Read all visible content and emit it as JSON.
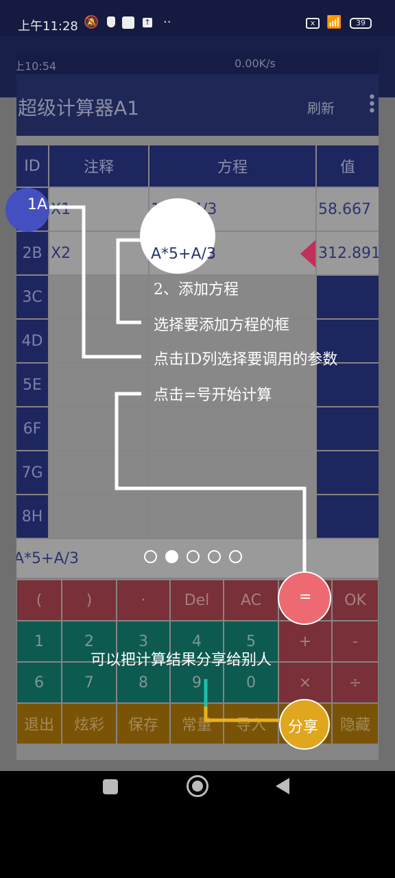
{
  "status_bar": {
    "time": "上午11:28",
    "battery": "39",
    "icons": [
      "mute-icon",
      "shield-alert-icon",
      "square-icon",
      "upload-icon",
      "more-dots-icon",
      "sim-x-icon",
      "wifi-icon",
      "battery-icon"
    ]
  },
  "inner_status": {
    "time": "上10:54",
    "speed": "0.00K/s"
  },
  "app_bar": {
    "title": "超级计算器A1",
    "refresh": "刷新"
  },
  "table": {
    "headers": [
      "ID",
      "注释",
      "方程",
      "值"
    ],
    "rows": [
      {
        "id": "1A",
        "note": "X1",
        "eq": "12*5-4/3",
        "val": "58.667"
      },
      {
        "id": "2B",
        "note": "X2",
        "eq": "A*5+A/3",
        "val": "312.891"
      },
      {
        "id": "3C",
        "note": "",
        "eq": "",
        "val": ""
      },
      {
        "id": "4D",
        "note": "",
        "eq": "",
        "val": ""
      },
      {
        "id": "5E",
        "note": "",
        "eq": "",
        "val": ""
      },
      {
        "id": "6F",
        "note": "",
        "eq": "",
        "val": ""
      },
      {
        "id": "7G",
        "note": "",
        "eq": "",
        "val": ""
      },
      {
        "id": "8H",
        "note": "",
        "eq": "",
        "val": ""
      }
    ]
  },
  "formula": "A*5+A/3",
  "pager": {
    "count": 5,
    "active": 1
  },
  "keypad": [
    [
      {
        "l": "(",
        "c": "r"
      },
      {
        "l": ")",
        "c": "r"
      },
      {
        "l": "·",
        "c": "r"
      },
      {
        "l": "Del",
        "c": "r"
      },
      {
        "l": "AC",
        "c": "r"
      },
      {
        "l": "=",
        "c": "r"
      },
      {
        "l": "OK",
        "c": "r"
      }
    ],
    [
      {
        "l": "1",
        "c": "g"
      },
      {
        "l": "2",
        "c": "g"
      },
      {
        "l": "3",
        "c": "g"
      },
      {
        "l": "4",
        "c": "g"
      },
      {
        "l": "5",
        "c": "g"
      },
      {
        "l": "+",
        "c": "r"
      },
      {
        "l": "-",
        "c": "r"
      }
    ],
    [
      {
        "l": "6",
        "c": "g"
      },
      {
        "l": "7",
        "c": "g"
      },
      {
        "l": "8",
        "c": "g"
      },
      {
        "l": "9",
        "c": "g"
      },
      {
        "l": "0",
        "c": "g"
      },
      {
        "l": "×",
        "c": "r"
      },
      {
        "l": "÷",
        "c": "r"
      }
    ],
    [
      {
        "l": "退出",
        "c": "y"
      },
      {
        "l": "炫彩",
        "c": "y"
      },
      {
        "l": "保存",
        "c": "y"
      },
      {
        "l": "常量",
        "c": "y"
      },
      {
        "l": "导入",
        "c": "y"
      },
      {
        "l": "分享",
        "c": "y"
      },
      {
        "l": "隐藏",
        "c": "y"
      }
    ]
  ],
  "tips": {
    "t1": "2、添加方程",
    "t2": "选择要添加方程的框",
    "t3": "点击ID列选择要调用的参数",
    "t4": "点击=号开始计算",
    "t5": "可以把计算结果分享给别人"
  },
  "colors": {
    "equals_highlight": "#ee6a72",
    "share_highlight": "#e0a61e",
    "id_highlight": "#4450c0"
  }
}
